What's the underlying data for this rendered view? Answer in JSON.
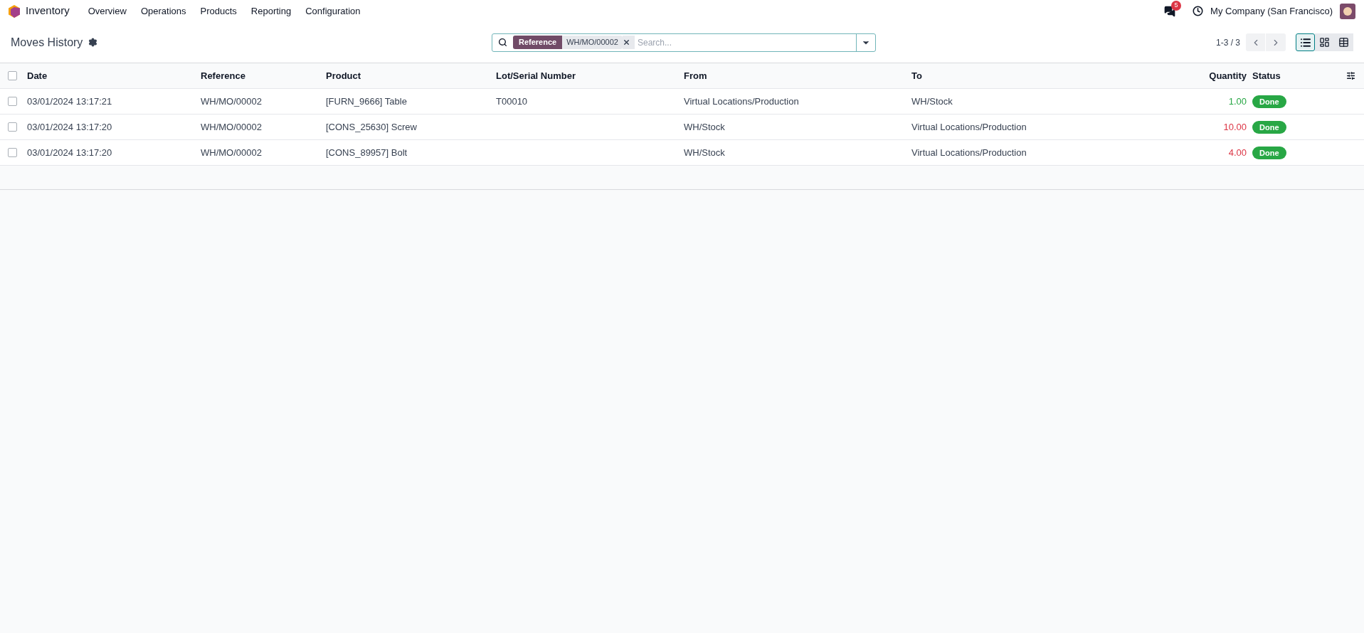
{
  "navbar": {
    "app_name": "Inventory",
    "menu": [
      "Overview",
      "Operations",
      "Products",
      "Reporting",
      "Configuration"
    ],
    "messages_badge": "5",
    "company": "My Company (San Francisco)"
  },
  "control_panel": {
    "title": "Moves History",
    "search": {
      "facet_label": "Reference",
      "facet_value": "WH/MO/00002",
      "placeholder": "Search..."
    },
    "pager": "1-3 / 3",
    "views": [
      {
        "kind": "list",
        "selected": true
      },
      {
        "kind": "kanban",
        "selected": false
      },
      {
        "kind": "pivot",
        "selected": false
      }
    ]
  },
  "table": {
    "select_all_checked": false,
    "columns": [
      "Date",
      "Reference",
      "Product",
      "Lot/Serial Number",
      "From",
      "To",
      "Quantity",
      "Status"
    ],
    "rows": [
      {
        "checked": false,
        "date": "03/01/2024 13:17:21",
        "reference": "WH/MO/00002",
        "product": "[FURN_9666] Table",
        "lot": "T00010",
        "from": "Virtual Locations/Production",
        "to": "WH/Stock",
        "quantity": "1.00",
        "kind": "incoming",
        "status": "Done"
      },
      {
        "checked": false,
        "date": "03/01/2024 13:17:20",
        "reference": "WH/MO/00002",
        "product": "[CONS_25630] Screw",
        "from": "WH/Stock",
        "to": "Virtual Locations/Production",
        "quantity": "10.00",
        "kind": "outgoing",
        "status": "Done"
      },
      {
        "checked": false,
        "date": "03/01/2024 13:17:20",
        "reference": "WH/MO/00002",
        "product": "[CONS_89957] Bolt",
        "from": "WH/Stock",
        "to": "Virtual Locations/Production",
        "quantity": "4.00",
        "kind": "outgoing",
        "status": "Done"
      }
    ]
  }
}
